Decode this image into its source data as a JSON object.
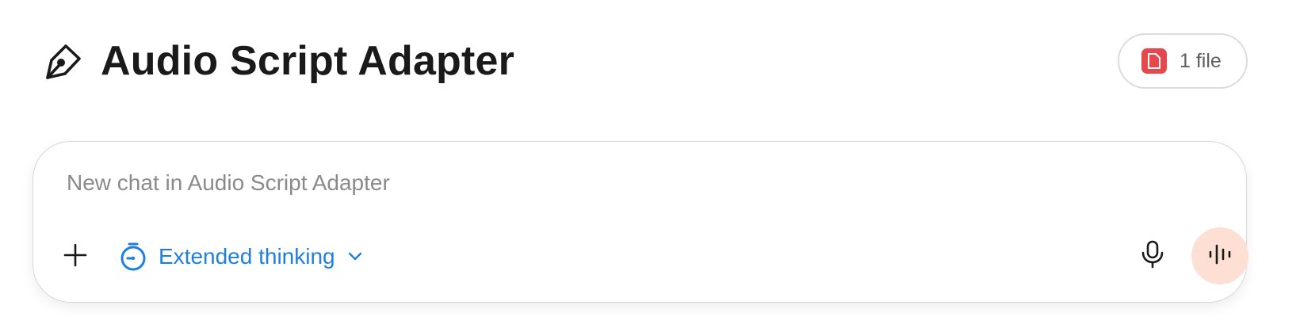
{
  "header": {
    "icon": "pen-nib-icon",
    "title": "Audio Script Adapter"
  },
  "files_badge": {
    "icon": "document-icon",
    "label": "1 file",
    "icon_color": "#e5484d"
  },
  "composer": {
    "placeholder": "New chat in Audio Script Adapter",
    "value": "",
    "add_icon": "plus-icon",
    "mode": {
      "icon": "stopwatch-icon",
      "label": "Extended thinking",
      "dropdown_icon": "chevron-down-icon",
      "color": "#1f7fe0"
    },
    "mic_icon": "microphone-icon",
    "voice_icon": "audio-waveform-icon",
    "voice_button_color": "#fde0d3"
  }
}
